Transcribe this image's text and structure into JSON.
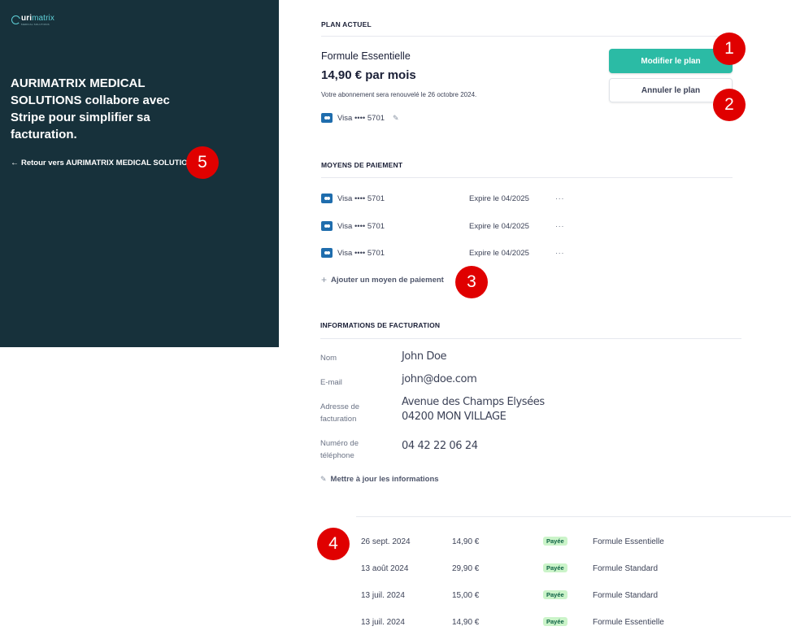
{
  "sidebar": {
    "logo_text_a": "uri",
    "logo_text_b": "matrix",
    "logo_subtext": "MEDICAL SOLUTIONS",
    "heading": "AURIMATRIX MEDICAL SOLUTIONS collabore avec Stripe pour simplifier sa facturation.",
    "back_link": "Retour vers AURIMATRIX MEDICAL SOLUTIONS"
  },
  "current_plan": {
    "section_title": "PLAN ACTUEL",
    "name": "Formule Essentielle",
    "price": "14,90 € par mois",
    "renewal": "Votre abonnement sera renouvelé le 26 octobre 2024.",
    "card_label": "Visa •••• 5701",
    "modify_label": "Modifier le plan",
    "cancel_label": "Annuler le plan"
  },
  "payment_methods": {
    "section_title": "MOYENS DE PAIEMENT",
    "items": [
      {
        "label": "Visa •••• 5701",
        "expiry": "Expire le 04/2025"
      },
      {
        "label": "Visa •••• 5701",
        "expiry": "Expire le 04/2025"
      },
      {
        "label": "Visa •••• 5701",
        "expiry": "Expire le 04/2025"
      }
    ],
    "more_label": "···",
    "add_label": "Ajouter un moyen de paiement"
  },
  "billing_info": {
    "section_title": "INFORMATIONS DE FACTURATION",
    "name_label": "Nom",
    "name_value": "John Doe",
    "email_label": "E-mail",
    "email_value": "john@doe.com",
    "address_label_1": "Adresse de",
    "address_label_2": "facturation",
    "address_line1": "Avenue des Champs Elysées",
    "address_line2": "04200 MON VILLAGE",
    "phone_label_1": "Numéro de",
    "phone_label_2": "téléphone",
    "phone_value": "04 42 22 06 24",
    "update_label": "Mettre à jour les informations"
  },
  "invoices": [
    {
      "date": "26 sept. 2024",
      "amount": "14,90 €",
      "status": "Payée",
      "plan": "Formule Essentielle"
    },
    {
      "date": "13 août 2024",
      "amount": "29,90 €",
      "status": "Payée",
      "plan": "Formule Standard"
    },
    {
      "date": "13 juil. 2024",
      "amount": "15,00 €",
      "status": "Payée",
      "plan": "Formule Standard"
    },
    {
      "date": "13 juil. 2024",
      "amount": "14,90 €",
      "status": "Payée",
      "plan": "Formule Essentielle"
    }
  ],
  "annotations": [
    "1",
    "2",
    "3",
    "4",
    "5"
  ],
  "colors": {
    "sidebar_bg": "#17313b",
    "primary_button": "#2bbba5",
    "annotation_badge": "#e00000",
    "paid_badge_bg": "#cbf4c9",
    "paid_badge_text": "#0e6245",
    "card_brand": "#1f6dad"
  },
  "icons": {
    "back": "arrow-left-icon",
    "card": "credit-card-icon",
    "edit": "edit-icon",
    "add": "plus-icon",
    "more": "more-horizontal-icon"
  }
}
